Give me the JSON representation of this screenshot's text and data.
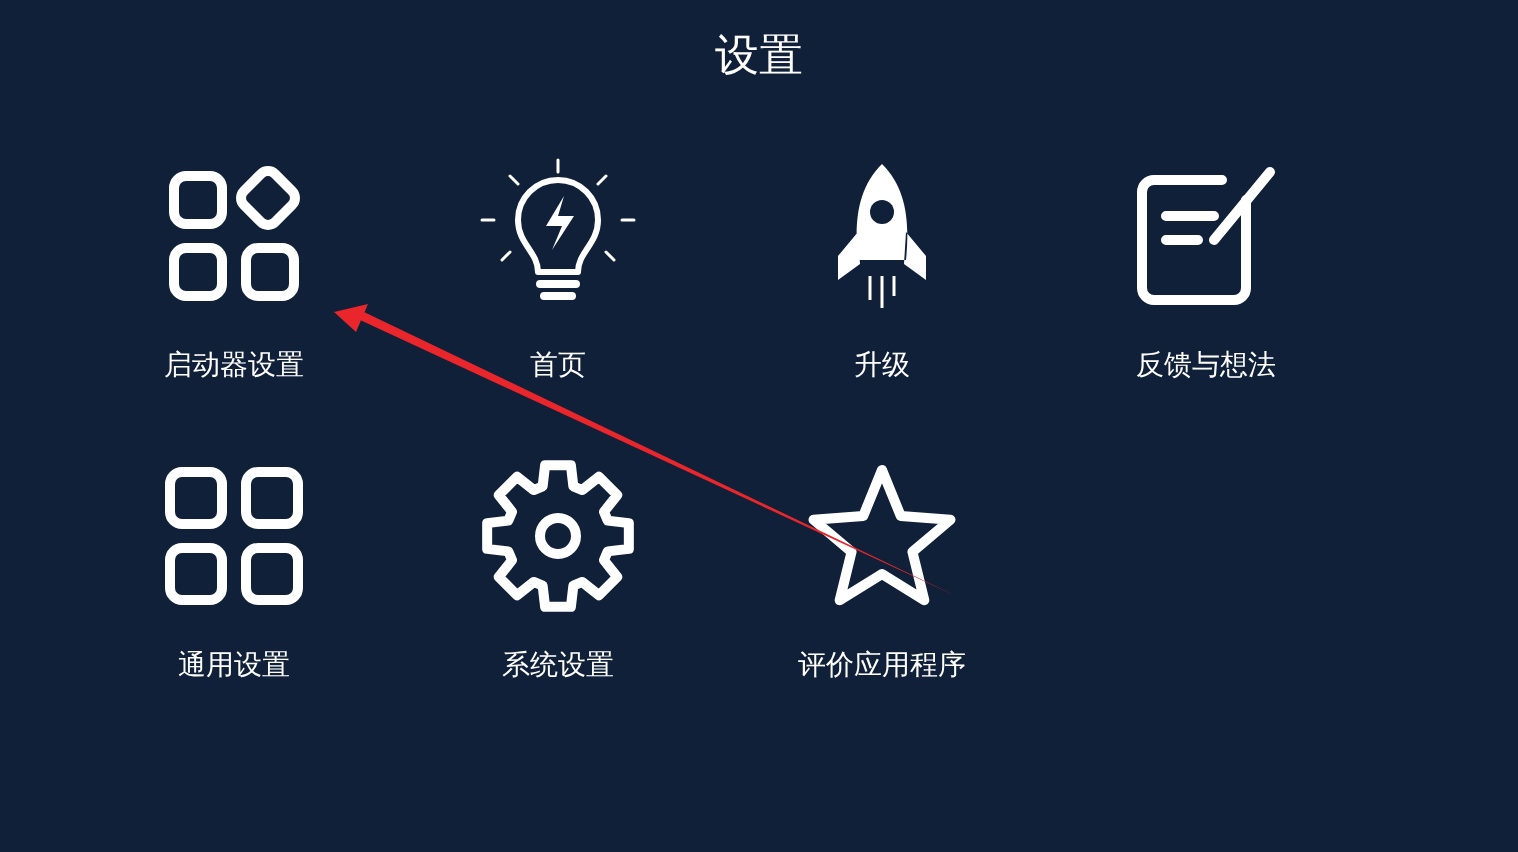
{
  "title": "设置",
  "items": [
    {
      "label": "启动器设置",
      "kind": "launcher"
    },
    {
      "label": "首页",
      "kind": "bulb"
    },
    {
      "label": "升级",
      "kind": "rocket"
    },
    {
      "label": "反馈与想法",
      "kind": "feedback"
    },
    {
      "label": "通用设置",
      "kind": "grid"
    },
    {
      "label": "系统设置",
      "kind": "gear"
    },
    {
      "label": "评价应用程序",
      "kind": "star"
    }
  ]
}
